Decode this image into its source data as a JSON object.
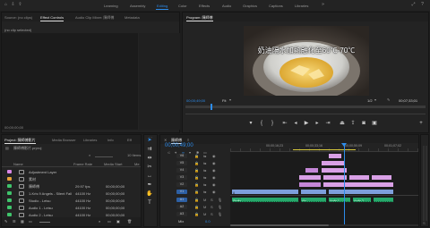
{
  "workspaces": [
    "Learning",
    "Assembly",
    "Editing",
    "Color",
    "Effects",
    "Audio",
    "Graphics",
    "Captions",
    "Libraries"
  ],
  "active_workspace": "Editing",
  "source_tabs": [
    "Source: (no clips)",
    "Effect Controls",
    "Audio Clip Mixer: 陳師傅",
    "Metadata"
  ],
  "effect_controls_empty": "(no clip selected)",
  "source_timecode": "00;00;00;00",
  "program": {
    "title": "Program: 陳師傅",
    "subtitle": "奶油隔水加熱融化至60℃-70℃",
    "timecode": "00;00;49;00",
    "fit": "Fit",
    "quality": "1/2",
    "duration": "00;07;33;01"
  },
  "project": {
    "tab": "Project: 陳師傅影片",
    "tabs_other": [
      "Media Browser",
      "Libraries",
      "Info",
      "Eff"
    ],
    "path": "陳師傅影片.prproj",
    "count": "10 Items",
    "columns": [
      "Name",
      "Frame Rate",
      "Media Start",
      "Me"
    ],
    "items": [
      {
        "name": "Adjustment Layer",
        "frame_rate": "",
        "media_start": "",
        "color": "#d986e6",
        "icon": "adjustment-layer-icon"
      },
      {
        "name": "素材",
        "frame_rate": "",
        "media_start": "",
        "color": "#e8a23a",
        "icon": "folder-icon"
      },
      {
        "name": "陳師傅",
        "frame_rate": "29.97 fps",
        "media_start": "00;00;00;00",
        "color": "#3fc46b",
        "icon": "sequence-icon"
      },
      {
        "name": "1-Kris 9 Angels - Silent Fall",
        "frame_rate": "44100 Hz",
        "media_start": "00;00;00;00",
        "color": "#3fc46b",
        "icon": "audio-icon"
      },
      {
        "name": "Studio - Leisu",
        "frame_rate": "44100 Hz",
        "media_start": "00;00;00;00",
        "color": "#3fc46b",
        "icon": "audio-icon"
      },
      {
        "name": "Audio 1 - Leisu",
        "frame_rate": "44100 Hz",
        "media_start": "00;00;00;00",
        "color": "#3fc46b",
        "icon": "audio-icon"
      },
      {
        "name": "Audio 2 - Leisu",
        "frame_rate": "44100 Hz",
        "media_start": "00;00;00;00",
        "color": "#3fc46b",
        "icon": "audio-icon"
      }
    ]
  },
  "timeline": {
    "tab": "陳師傅",
    "timecode": "00;00;49;00",
    "ruler": [
      "00;00;16;23",
      "00;00;33;16",
      "00;00;50;09",
      "00;01;07;02"
    ],
    "video_tracks": [
      "V6",
      "V5",
      "V4",
      "V3",
      "V2",
      "V1"
    ],
    "audio_tracks": [
      "A1",
      "A2",
      "A3"
    ],
    "mix": "Mix",
    "mix_value": "0.0",
    "clip_labels": {
      "blue_clip": "A",
      "audio1": "Studio",
      "audio2": "Alo...",
      "audio3": "Audio 1",
      "audio4": "Audio 2"
    }
  },
  "colors": {
    "accent": "#2d8ceb",
    "adjustment": "#d9a0e6",
    "video_clip": "#7d9fdc",
    "audio_clip": "#27a86b",
    "playhead": "#2d8ceb"
  }
}
